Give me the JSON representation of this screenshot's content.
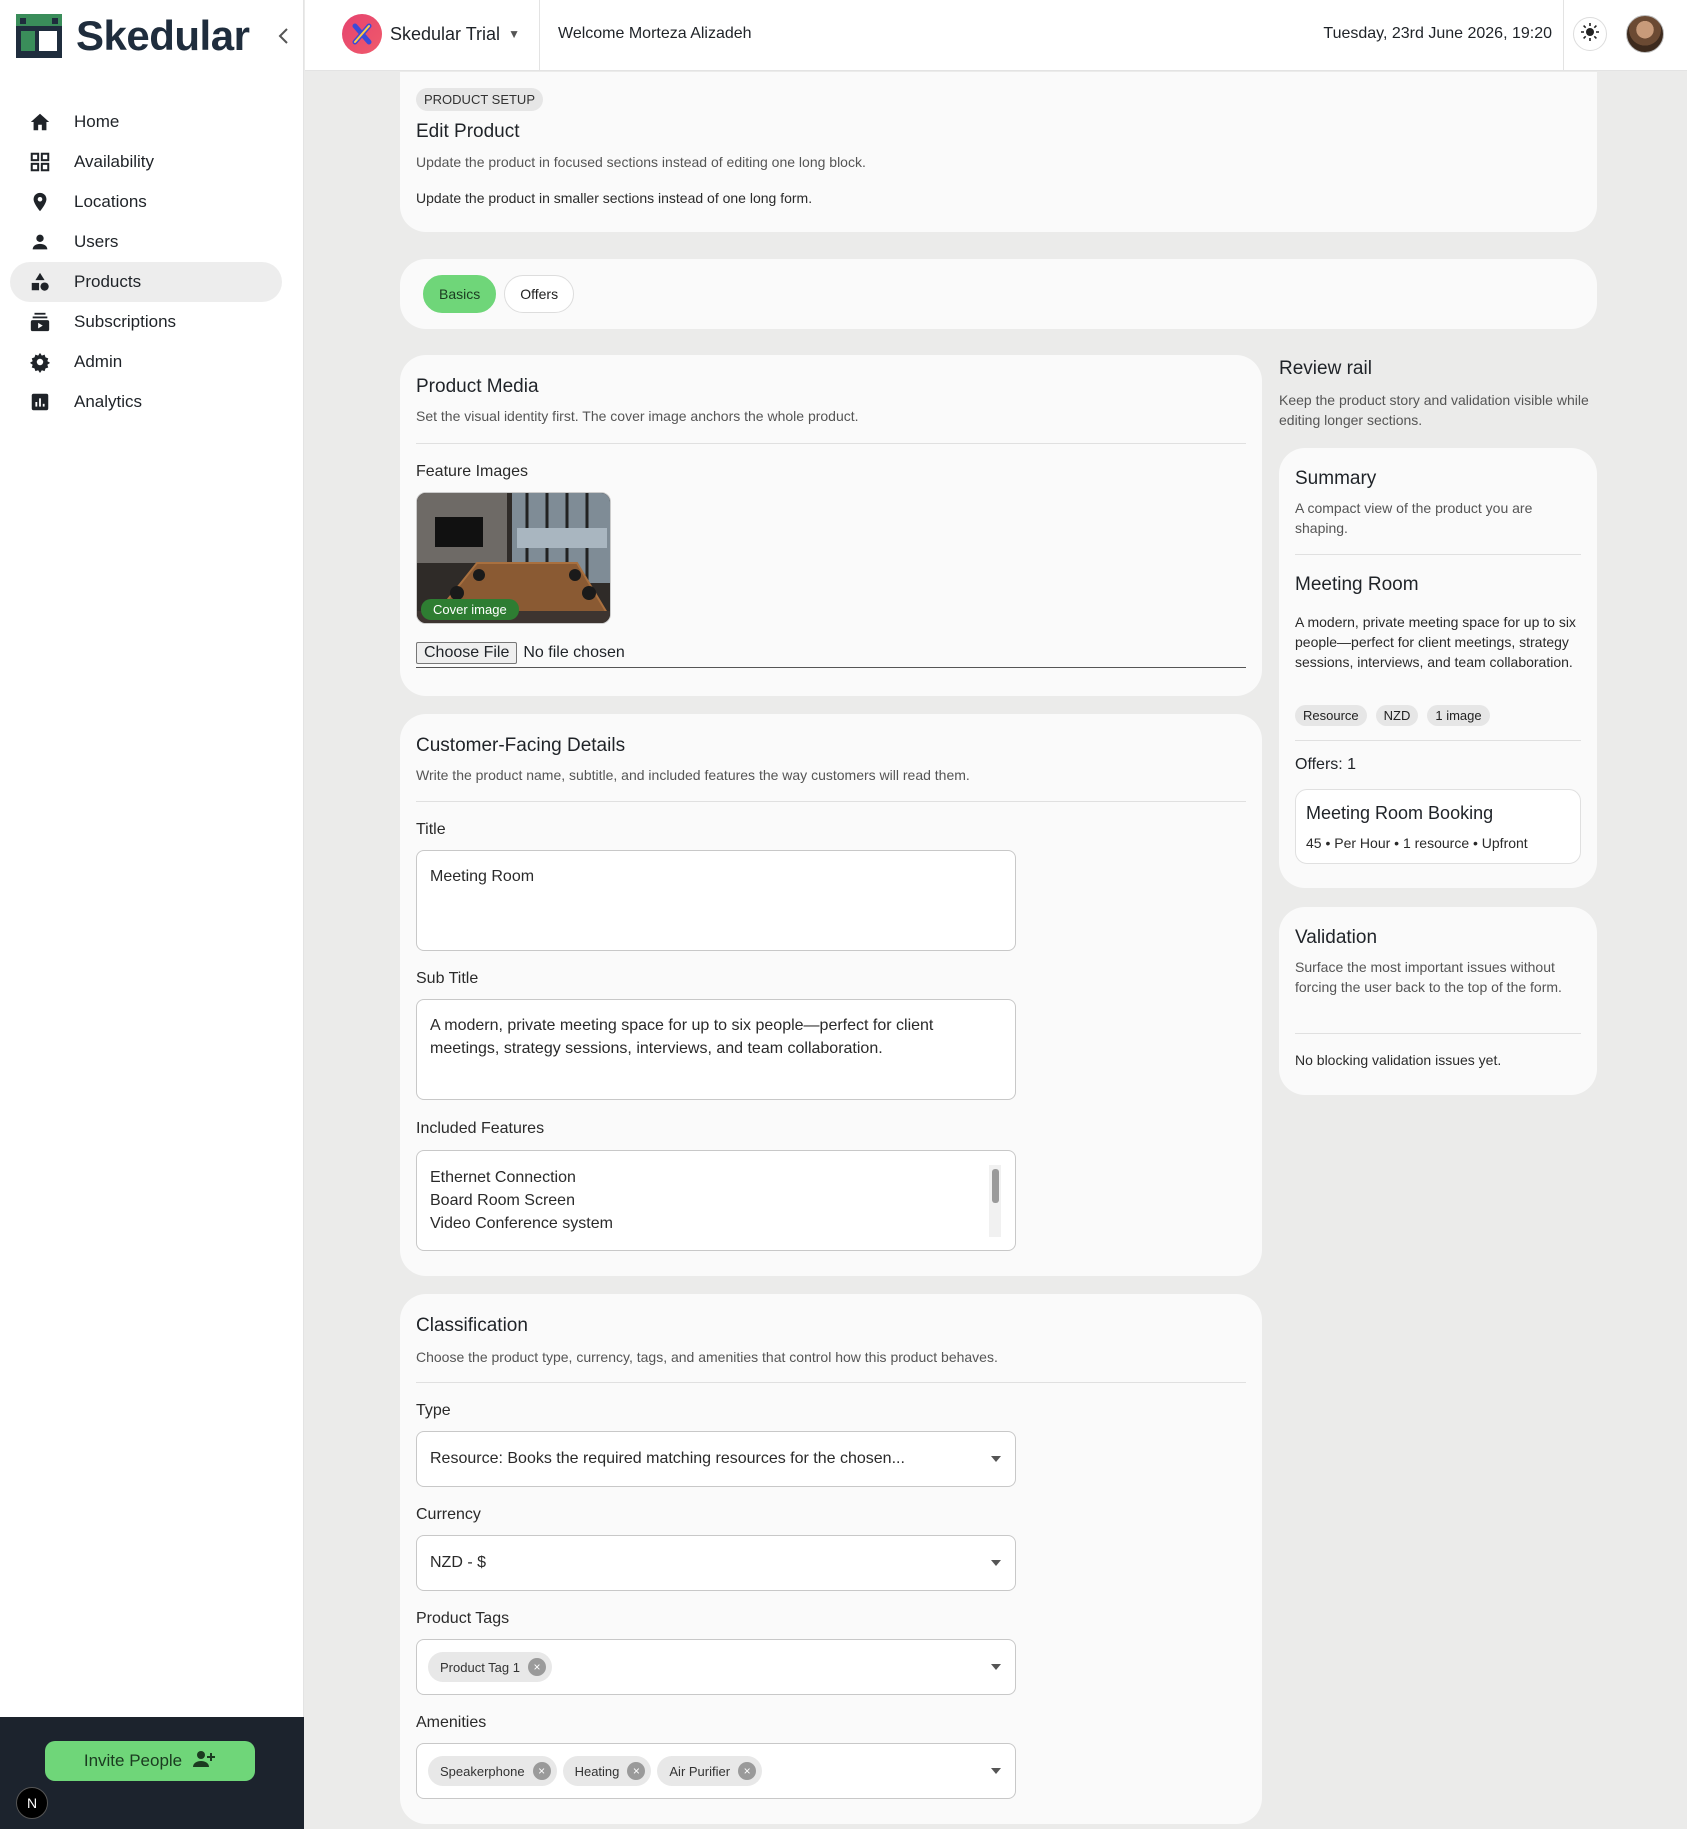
{
  "brand": {
    "name": "Skedular"
  },
  "sidebar": {
    "items": [
      {
        "label": "Home",
        "icon": "home-icon"
      },
      {
        "label": "Availability",
        "icon": "grid-icon"
      },
      {
        "label": "Locations",
        "icon": "location-pin-icon"
      },
      {
        "label": "Users",
        "icon": "user-icon"
      },
      {
        "label": "Products",
        "icon": "shapes-icon",
        "active": true
      },
      {
        "label": "Subscriptions",
        "icon": "subscriptions-icon"
      },
      {
        "label": "Admin",
        "icon": "gear-icon"
      },
      {
        "label": "Analytics",
        "icon": "analytics-icon"
      }
    ],
    "invite_label": "Invite People",
    "badge": "N"
  },
  "header": {
    "org_name": "Skedular Trial",
    "welcome": "Welcome Morteza Alizadeh",
    "datetime": "Tuesday, 23rd June 2026, 19:20"
  },
  "setup": {
    "chip": "PRODUCT SETUP",
    "title": "Edit Product",
    "subtitle": "Update the product in focused sections instead of editing one long block.",
    "note": "Update the product in smaller sections instead of one long form."
  },
  "tabs": [
    {
      "label": "Basics",
      "active": true
    },
    {
      "label": "Offers",
      "active": false
    }
  ],
  "media": {
    "title": "Product Media",
    "subtitle": "Set the visual identity first. The cover image anchors the whole product.",
    "feature_label": "Feature Images",
    "cover_badge": "Cover image",
    "choose_file": "Choose File",
    "no_file": "No file chosen"
  },
  "details": {
    "title": "Customer-Facing Details",
    "subtitle": "Write the product name, subtitle, and included features the way customers will read them.",
    "title_label": "Title",
    "title_value": "Meeting Room",
    "subtitle_label": "Sub Title",
    "subtitle_value": "A modern, private meeting space for up to six people—perfect for client meetings, strategy sessions, interviews, and team collaboration.",
    "features_label": "Included Features",
    "features": [
      "Ethernet Connection",
      "Board Room Screen",
      "Video Conference system"
    ]
  },
  "classification": {
    "title": "Classification",
    "subtitle": "Choose the product type, currency, tags, and amenities that control how this product behaves.",
    "type_label": "Type",
    "type_value": "Resource: Books the required matching resources for the chosen...",
    "currency_label": "Currency",
    "currency_value": "NZD - $",
    "tags_label": "Product Tags",
    "tags": [
      "Product Tag 1"
    ],
    "amenities_label": "Amenities",
    "amenities": [
      "Speakerphone",
      "Heating",
      "Air Purifier"
    ]
  },
  "review": {
    "title": "Review rail",
    "subtitle": "Keep the product story and validation visible while editing longer sections.",
    "summary_title": "Summary",
    "summary_sub": "A compact view of the product you are shaping.",
    "product_name": "Meeting Room",
    "product_desc": "A modern, private meeting space for up to six people—perfect for client meetings, strategy sessions, interviews, and team collaboration.",
    "chips": [
      "Resource",
      "NZD",
      "1 image"
    ],
    "offers_count": "Offers: 1",
    "offer_name": "Meeting Room Booking",
    "offer_meta": "45 • Per Hour • 1 resource • Upfront",
    "validation_title": "Validation",
    "validation_sub": "Surface the most important issues without forcing the user back to the top of the form.",
    "validation_status": "No blocking validation issues yet."
  },
  "colors": {
    "accent": "#6fd679",
    "sidebar_footer": "#1c232d",
    "brand_dark": "#1f2d3d",
    "cover_badge": "#2e7d32"
  }
}
